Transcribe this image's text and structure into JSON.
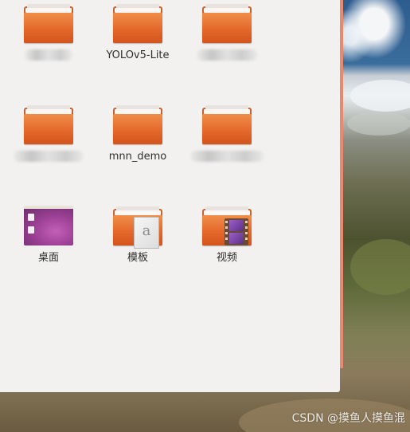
{
  "files": [
    {
      "label": "",
      "kind": "folder",
      "redacted": true
    },
    {
      "label": "YOLOv5-Lite",
      "kind": "folder"
    },
    {
      "label": "",
      "kind": "folder",
      "redacted": true
    },
    {
      "label": "",
      "kind": "folder",
      "redacted": true
    },
    {
      "label": "mnn_demo",
      "kind": "folder"
    },
    {
      "label": "",
      "kind": "folder",
      "redacted": true
    },
    {
      "label": "桌面",
      "kind": "desktop-folder"
    },
    {
      "label": "模板",
      "kind": "templates-folder"
    },
    {
      "label": "视频",
      "kind": "videos-folder"
    }
  ],
  "colors": {
    "folder_orange": "#e4682a",
    "window_bg": "#f2f1f0",
    "window_edge": "#e58b6f"
  },
  "watermark": "CSDN @摸鱼人摸鱼混"
}
